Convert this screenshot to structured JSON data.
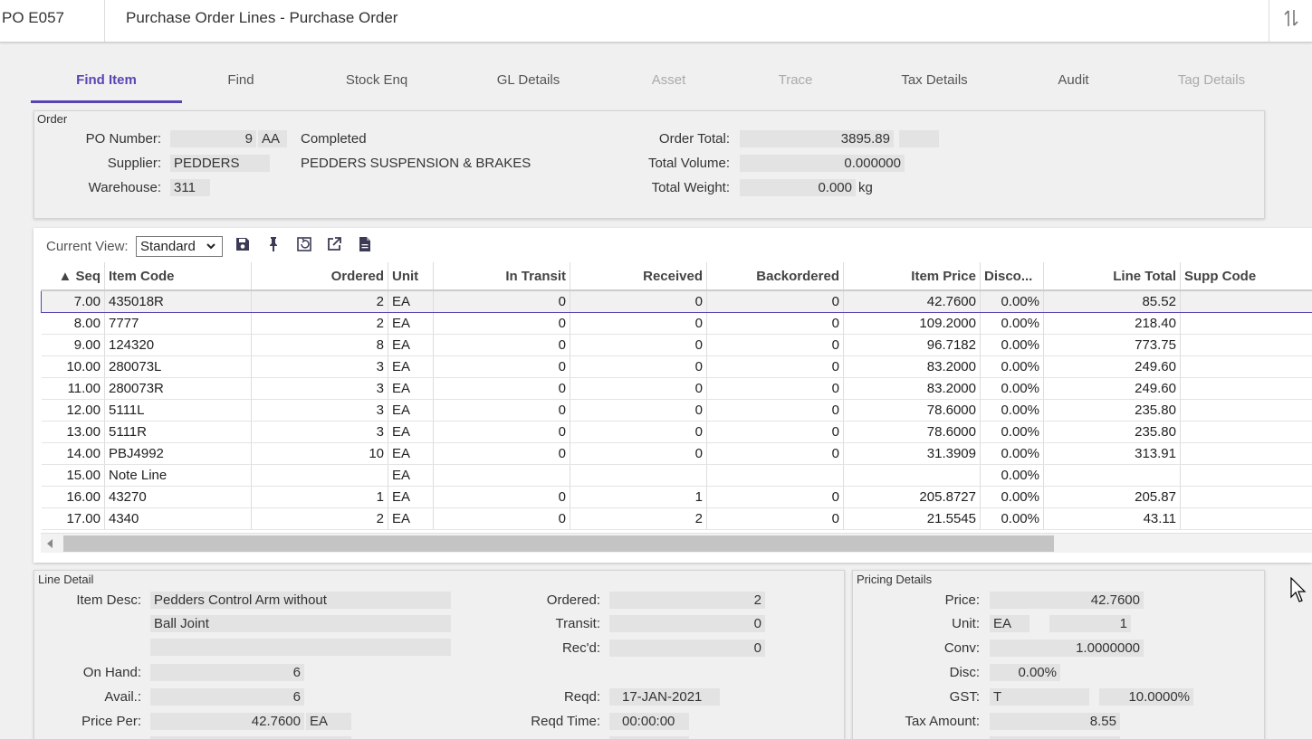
{
  "header": {
    "code": "PO E057",
    "title": "Purchase Order Lines - Purchase Order"
  },
  "tabs": [
    {
      "label": "Find Item",
      "state": "active"
    },
    {
      "label": "Find",
      "state": "normal"
    },
    {
      "label": "Stock Enq",
      "state": "normal"
    },
    {
      "label": "GL Details",
      "state": "normal"
    },
    {
      "label": "Asset",
      "state": "disabled"
    },
    {
      "label": "Trace",
      "state": "disabled"
    },
    {
      "label": "Tax Details",
      "state": "normal"
    },
    {
      "label": "Audit",
      "state": "normal"
    },
    {
      "label": "Tag Details",
      "state": "disabled"
    }
  ],
  "order": {
    "legend": "Order",
    "po_number_label": "PO Number:",
    "po_number": "9",
    "po_type": "AA",
    "status": "Completed",
    "supplier_label": "Supplier:",
    "supplier_code": "PEDDERS",
    "supplier_name": "PEDDERS SUSPENSION & BRAKES",
    "warehouse_label": "Warehouse:",
    "warehouse": "311",
    "order_total_label": "Order Total:",
    "order_total": "3895.89",
    "order_total_extra": "",
    "total_volume_label": "Total Volume:",
    "total_volume": "0.000000",
    "total_weight_label": "Total Weight:",
    "total_weight": "0.000",
    "weight_unit": "kg"
  },
  "grid": {
    "current_view_label": "Current View:",
    "current_view": "Standard",
    "columns": [
      "▲ Seq",
      "Item Code",
      "Ordered",
      "Unit",
      "In Transit",
      "Received",
      "Backordered",
      "Item Price",
      "Disco...",
      "Line Total",
      "Supp Code"
    ],
    "rows": [
      [
        "7.00",
        "435018R",
        "2",
        "EA",
        "0",
        "0",
        "0",
        "42.7600",
        "0.00%",
        "85.52",
        ""
      ],
      [
        "8.00",
        "7777",
        "2",
        "EA",
        "0",
        "0",
        "0",
        "109.2000",
        "0.00%",
        "218.40",
        ""
      ],
      [
        "9.00",
        "124320",
        "8",
        "EA",
        "0",
        "0",
        "0",
        "96.7182",
        "0.00%",
        "773.75",
        ""
      ],
      [
        "10.00",
        "280073L",
        "3",
        "EA",
        "0",
        "0",
        "0",
        "83.2000",
        "0.00%",
        "249.60",
        ""
      ],
      [
        "11.00",
        "280073R",
        "3",
        "EA",
        "0",
        "0",
        "0",
        "83.2000",
        "0.00%",
        "249.60",
        ""
      ],
      [
        "12.00",
        "5111L",
        "3",
        "EA",
        "0",
        "0",
        "0",
        "78.6000",
        "0.00%",
        "235.80",
        ""
      ],
      [
        "13.00",
        "5111R",
        "3",
        "EA",
        "0",
        "0",
        "0",
        "78.6000",
        "0.00%",
        "235.80",
        ""
      ],
      [
        "14.00",
        "PBJ4992",
        "10",
        "EA",
        "0",
        "0",
        "0",
        "31.3909",
        "0.00%",
        "313.91",
        ""
      ],
      [
        "15.00",
        "Note Line",
        "",
        "EA",
        "",
        "",
        "",
        "",
        "0.00%",
        "",
        ""
      ],
      [
        "16.00",
        "43270",
        "1",
        "EA",
        "0",
        "1",
        "0",
        "205.8727",
        "0.00%",
        "205.87",
        ""
      ],
      [
        "17.00",
        "4340",
        "2",
        "EA",
        "0",
        "2",
        "0",
        "21.5545",
        "0.00%",
        "43.11",
        ""
      ]
    ]
  },
  "line_detail": {
    "legend": "Line Detail",
    "item_desc_label": "Item Desc:",
    "item_desc_1": "Pedders Control Arm without",
    "item_desc_2": "Ball Joint",
    "item_desc_3": "",
    "on_hand_label": "On Hand:",
    "on_hand": "6",
    "avail_label": "Avail.:",
    "avail": "6",
    "price_per_label": "Price Per:",
    "price_per": "42.7600",
    "price_per_unit": "EA",
    "ordered_label": "Ordered:",
    "ordered": "2",
    "transit_label": "Transit:",
    "transit": "0",
    "recd_label": "Rec'd:",
    "recd": "0",
    "reqd_label": "Reqd:",
    "reqd": "17-JAN-2021",
    "reqd_time_label": "Reqd Time:",
    "reqd_time": "00:00:00"
  },
  "pricing": {
    "legend": "Pricing Details",
    "price_label": "Price:",
    "price": "42.7600",
    "unit_label": "Unit:",
    "unit": "EA",
    "unit_qty": "1",
    "conv_label": "Conv:",
    "conv": "1.0000000",
    "disc_label": "Disc:",
    "disc": "0.00%",
    "gst_label": "GST:",
    "gst_code": "T",
    "gst_rate": "10.0000%",
    "tax_amount_label": "Tax Amount:",
    "tax_amount": "8.55"
  }
}
